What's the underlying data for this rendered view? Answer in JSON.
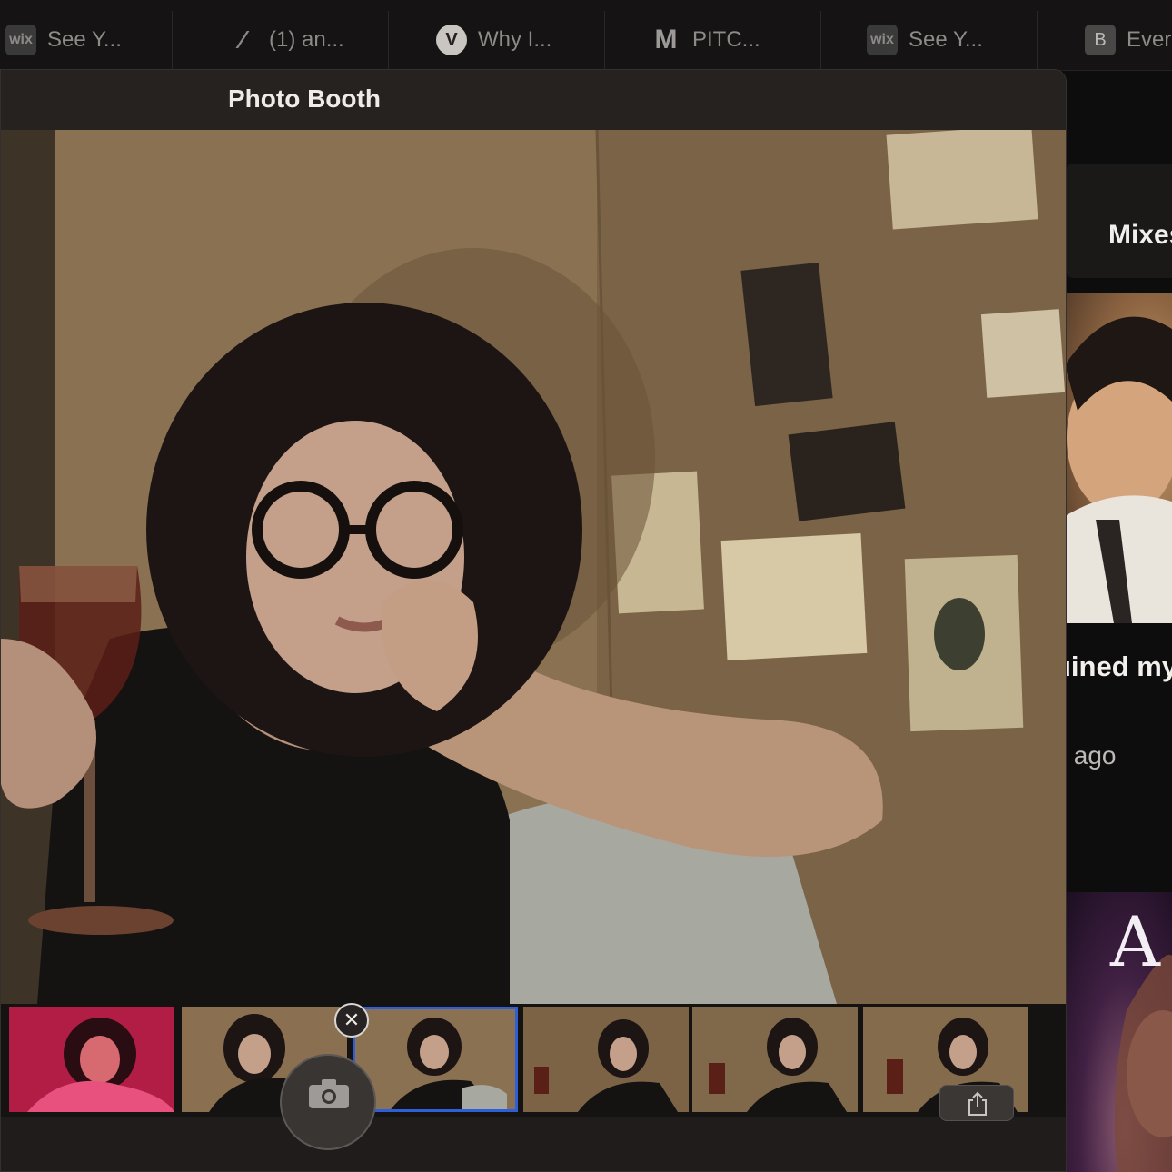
{
  "browser": {
    "tabs": [
      {
        "favicon": "wix-logo-icon",
        "favicon_text": "wix",
        "title": "See Y..."
      },
      {
        "favicon": "slash-icon",
        "favicon_text": "⁄",
        "title": "(1) an..."
      },
      {
        "favicon": "v-logo-icon",
        "favicon_text": "V",
        "title": "Why I..."
      },
      {
        "favicon": "gmail-icon",
        "favicon_text": "M",
        "title": "PITC..."
      },
      {
        "favicon": "wix-logo-icon",
        "favicon_text": "wix",
        "title": "See Y..."
      },
      {
        "favicon": "b-logo-icon",
        "favicon_text": "B",
        "title": "Ever"
      }
    ]
  },
  "window": {
    "title": "Photo Booth"
  },
  "filmstrip": {
    "thumbnail_count": 6,
    "selected_index": 2,
    "delete_glyph": "✕"
  },
  "background_page": {
    "section_label": "Mixes",
    "video_title": "uined my",
    "video_meta": "s ago",
    "thumb_letter": "A"
  },
  "colors": {
    "selection_outline": "#2e5fd8",
    "window_bg": "#1b1918",
    "titlebar_bg": "#252220"
  }
}
